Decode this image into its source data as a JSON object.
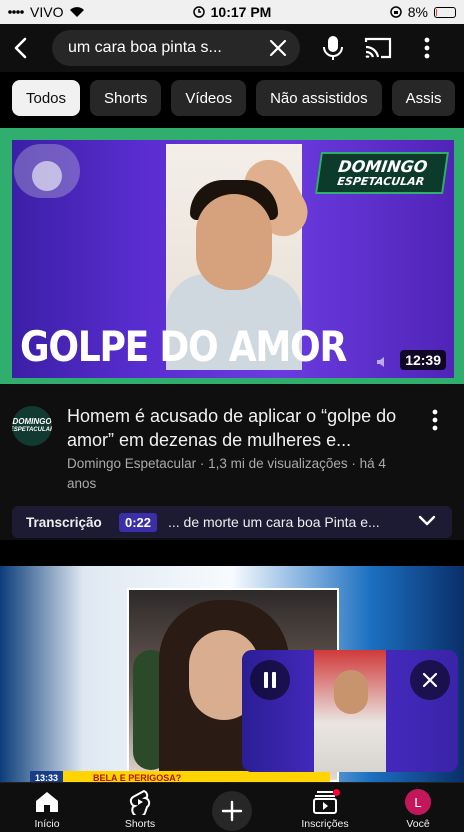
{
  "status_bar": {
    "carrier": "VIVO",
    "time": "10:17 PM",
    "battery": "8%",
    "battery_level": 0.08,
    "icons": [
      "signal-icon",
      "wifi-icon",
      "alarm-icon",
      "lock-rotation-icon",
      "battery-icon"
    ]
  },
  "search": {
    "query": "um cara boa pinta s...",
    "icons": [
      "back-arrow-icon",
      "clear-icon",
      "mic-icon",
      "cast-icon",
      "more-vert-icon"
    ]
  },
  "chips": [
    {
      "label": "Todos",
      "active": true
    },
    {
      "label": "Shorts",
      "active": false
    },
    {
      "label": "Vídeos",
      "active": false
    },
    {
      "label": "Não assistidos",
      "active": false
    },
    {
      "label": "Assis",
      "active": false
    }
  ],
  "video1": {
    "thumbnail_title": "GOLPE DO AMOR",
    "logo_line1": "DOMINGO",
    "logo_line2": "ESPETACULAR",
    "duration": "12:39",
    "title": "Homem é acusado de aplicar o “golpe do amor” em dezenas de mulheres e...",
    "channel": "Domingo Espetacular",
    "meta": "Domingo Espetacular · 1,3 mi de visualizações · há 4 anos",
    "avatar_line1": "DOMINGO",
    "avatar_line2": "ESPETACULAR",
    "highlight_color": "#2fae6e",
    "transcript": {
      "label": "Transcrição",
      "time": "0:22",
      "text": "... de morte um cara boa Pinta e..."
    }
  },
  "video2": {
    "ticker_time": "13:33",
    "ticker_caption": "BELA E PERIGOSA?"
  },
  "miniplayer": {
    "icons": [
      "pause-icon",
      "close-icon"
    ]
  },
  "bottom_nav": [
    {
      "label": "Início",
      "icon": "home-icon"
    },
    {
      "label": "Shorts",
      "icon": "shorts-icon"
    },
    {
      "label": "",
      "icon": "add-icon"
    },
    {
      "label": "Inscrições",
      "icon": "subscriptions-icon"
    },
    {
      "label": "Você",
      "icon": "avatar",
      "avatar_letter": "L"
    }
  ]
}
